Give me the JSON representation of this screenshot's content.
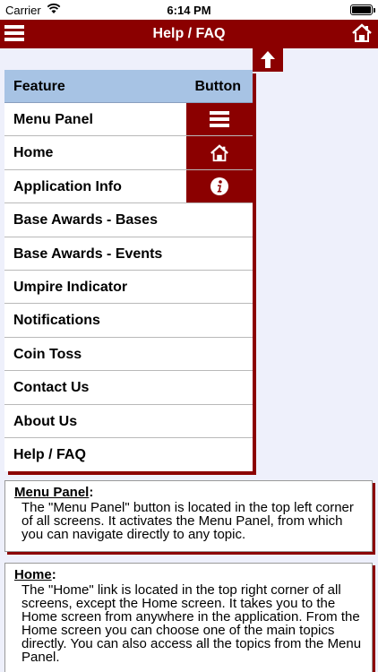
{
  "status_bar": {
    "carrier": "Carrier",
    "time": "6:14 PM"
  },
  "nav": {
    "title": "Help / FAQ"
  },
  "table": {
    "headers": {
      "feature": "Feature",
      "button": "Button"
    },
    "rows": [
      {
        "label": "Menu Panel",
        "button_icon": "menu-icon"
      },
      {
        "label": "Home",
        "button_icon": "home-icon"
      },
      {
        "label": "Application Info",
        "button_icon": "info-icon"
      },
      {
        "label": "Base Awards - Bases"
      },
      {
        "label": "Base Awards - Events"
      },
      {
        "label": "Umpire Indicator"
      },
      {
        "label": "Notifications"
      },
      {
        "label": "Coin Toss"
      },
      {
        "label": "Contact Us"
      },
      {
        "label": "About Us"
      },
      {
        "label": "Help / FAQ"
      }
    ]
  },
  "cards": [
    {
      "title": "Menu Panel",
      "colon": ":",
      "body": "The \"Menu Panel\" button is located in the top left corner of all screens. It activates the Menu Panel, from which you can navigate directly to any topic."
    },
    {
      "title": "Home",
      "colon": ":",
      "body": "The \"Home\" link is located in the top right corner of all screens, except the Home screen. It takes you to the Home screen from anywhere in the application. From the Home screen you can choose one of the main topics directly. You can also access all the topics from the Menu Panel."
    }
  ],
  "colors": {
    "brand": "#8b0000",
    "header": "#a7c3e4",
    "background": "#eef0fb"
  }
}
